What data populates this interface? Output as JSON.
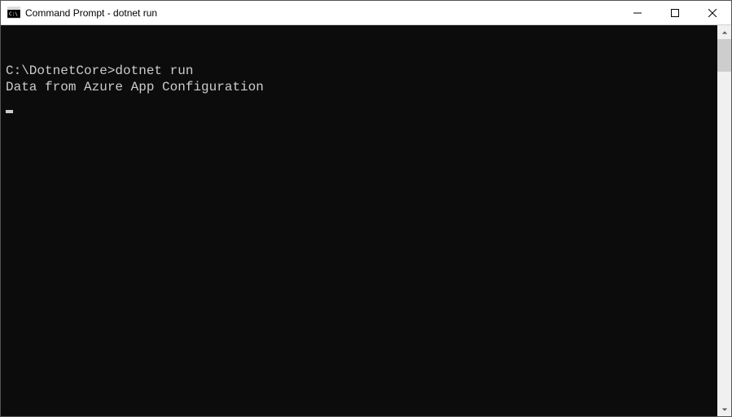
{
  "window": {
    "title": "Command Prompt - dotnet  run"
  },
  "terminal": {
    "prompt": "C:\\DotnetCore>",
    "command": "dotnet run",
    "output_line1": "Data from Azure App Configuration"
  }
}
